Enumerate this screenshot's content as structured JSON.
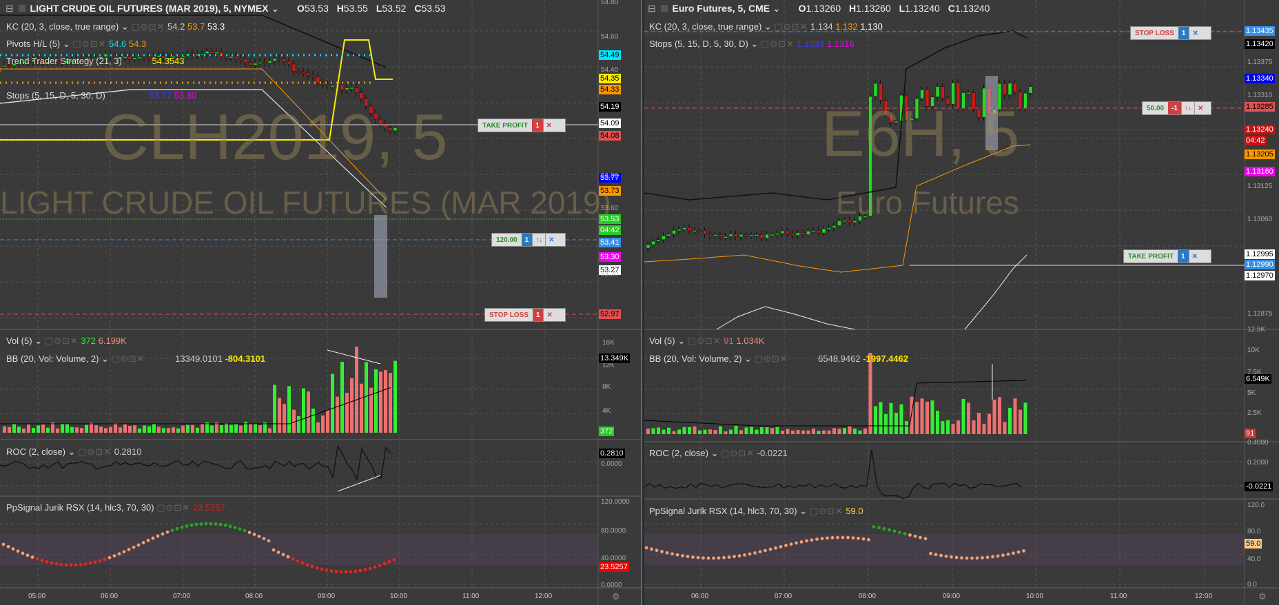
{
  "left": {
    "title": "LIGHT CRUDE OIL FUTURES (MAR 2019), 5, NYMEX",
    "ohlc": {
      "o_label": "O",
      "o": "53.53",
      "h_label": "H",
      "h": "53.55",
      "l_label": "L",
      "l": "53.52",
      "c_label": "C",
      "c": "53.53"
    },
    "indicators": {
      "kc": {
        "name": "KC (20, 3, close, true range)",
        "v1": "54.2",
        "v2": "53.7",
        "v3": "53.3"
      },
      "pivots": {
        "name": "Pivots H/L (5)",
        "v1": "54.6",
        "v2": "54.3"
      },
      "trend": {
        "name": "Trend Trader Strategy (21, 3)",
        "v1": "54.3543"
      },
      "stops": {
        "name": "Stops (5, 15, D, 5, 30, D)",
        "v1": "53.77",
        "v2": "53.30"
      },
      "vol": {
        "name": "Vol (5)",
        "v1": "372",
        "v2": "6.199K"
      },
      "bb": {
        "name": "BB (20, Vol: Volume, 2)",
        "v1": "13349.0101",
        "v2": "-804.3101"
      },
      "roc": {
        "name": "ROC (2, close)",
        "v1": "0.2810"
      },
      "rsx": {
        "name": "PpSignal Jurik RSX (14, hlc3, 70, 30)",
        "v1": "23.5257"
      }
    },
    "watermark_symbol": "CLH2019, 5",
    "watermark_name": "LIGHT CRUDE OIL FUTURES (MAR 2019)",
    "price_labels": [
      {
        "text": "54.49",
        "bg": "#00e5ff",
        "fg": "#000"
      },
      {
        "text": "54.35",
        "bg": "#ffeb00",
        "fg": "#000"
      },
      {
        "text": "54.33",
        "bg": "#ff9800",
        "fg": "#000"
      },
      {
        "text": "54.19",
        "bg": "#000000",
        "fg": "#fff"
      },
      {
        "text": "54.09",
        "bg": "#ffffff",
        "fg": "#000"
      },
      {
        "text": "54.08",
        "bg": "#e05050",
        "fg": "#000"
      },
      {
        "text": "53.77",
        "bg": "#0000ee",
        "fg": "#fff"
      },
      {
        "text": "53.73",
        "bg": "#ff9800",
        "fg": "#000"
      },
      {
        "text": "53.53",
        "bg": "#22cc22",
        "fg": "#fff"
      },
      {
        "text": "04:42",
        "bg": "#22cc22",
        "fg": "#fff"
      },
      {
        "text": "53.41",
        "bg": "#3a8ee6",
        "fg": "#fff"
      },
      {
        "text": "53.30",
        "bg": "#ee00ee",
        "fg": "#fff"
      },
      {
        "text": "53.27",
        "bg": "#ffffff",
        "fg": "#000"
      },
      {
        "text": "52.97",
        "bg": "#e05050",
        "fg": "#000"
      }
    ],
    "price_ticks": [
      "54.80",
      "54.60",
      "54.40",
      "53.80",
      "53.60",
      "53.20"
    ],
    "vol_label": {
      "text": "13.349K",
      "bg": "#000",
      "fg": "#fff"
    },
    "vol_label2": {
      "text": "372",
      "bg": "#22cc22",
      "fg": "#fff"
    },
    "vol_ticks": [
      "16K",
      "12K",
      "8K",
      "4K"
    ],
    "roc_label": {
      "text": "0.2810",
      "bg": "#000",
      "fg": "#fff"
    },
    "roc_ticks": [
      "0.0000"
    ],
    "rsx_label": {
      "text": "23.5257",
      "bg": "#ee0000",
      "fg": "#fff"
    },
    "rsx_ticks": [
      "120.0000",
      "80.0000",
      "40.0000",
      "0.0000"
    ],
    "time_ticks": [
      "05:00",
      "06:00",
      "07:00",
      "08:00",
      "09:00",
      "10:00",
      "11:00",
      "12:00"
    ],
    "orders": {
      "take_profit": {
        "label": "TAKE PROFIT",
        "qty": "1"
      },
      "position": {
        "label": "120.00",
        "qty": "1",
        "arrows": "↑↓"
      },
      "stop_loss": {
        "label": "STOP LOSS",
        "qty": "1"
      }
    }
  },
  "right": {
    "title": "Euro Futures, 5, CME",
    "ohlc": {
      "o_label": "O",
      "o": "1.13260",
      "h_label": "H",
      "h": "1.13260",
      "l_label": "L",
      "l": "1.13240",
      "c_label": "C",
      "c": "1.13240"
    },
    "indicators": {
      "kc": {
        "name": "KC (20, 3, close, true range)",
        "v1": "1.134",
        "v2": "1.132",
        "v3": "1.130"
      },
      "stops": {
        "name": "Stops (5, 15, D, 5, 30, D)",
        "v1": "1.1334",
        "v2": "1.1316"
      },
      "vol": {
        "name": "Vol (5)",
        "v1": "91",
        "v2": "1.034K"
      },
      "bb": {
        "name": "BB (20, Vol: Volume, 2)",
        "v1": "6548.9462",
        "v2": "-1997.4462"
      },
      "roc": {
        "name": "ROC (2, close)",
        "v1": "-0.0221"
      },
      "rsx": {
        "name": "PpSignal Jurik RSX (14, hlc3, 70, 30)",
        "v1": "59.0"
      }
    },
    "watermark_symbol": "E6H, 5",
    "watermark_name": "Euro Futures",
    "price_labels": [
      {
        "text": "1.13435",
        "bg": "#3a8ee6",
        "fg": "#fff"
      },
      {
        "text": "1.13420",
        "bg": "#000000",
        "fg": "#fff"
      },
      {
        "text": "1.13340",
        "bg": "#0000ee",
        "fg": "#fff"
      },
      {
        "text": "1.13285",
        "bg": "#e05050",
        "fg": "#000"
      },
      {
        "text": "1.13240",
        "bg": "#cc1111",
        "fg": "#fff"
      },
      {
        "text": "04:42",
        "bg": "#cc1111",
        "fg": "#fff"
      },
      {
        "text": "1.13205",
        "bg": "#ff9800",
        "fg": "#000"
      },
      {
        "text": "1.13160",
        "bg": "#ee00ee",
        "fg": "#fff"
      },
      {
        "text": "1.12995",
        "bg": "#ffffff",
        "fg": "#000"
      },
      {
        "text": "1.12990",
        "bg": "#3a8ee6",
        "fg": "#fff"
      },
      {
        "text": "1.12970",
        "bg": "#ffffff",
        "fg": "#000"
      }
    ],
    "price_ticks": [
      "1.13375",
      "1.13310",
      "1.13125",
      "1.13060",
      "1.12875"
    ],
    "vol_label": {
      "text": "6.549K",
      "bg": "#000",
      "fg": "#fff"
    },
    "vol_label2": {
      "text": "91",
      "bg": "#cc3333",
      "fg": "#fff"
    },
    "vol_ticks": [
      "12.5K",
      "10K",
      "7.5K",
      "5K",
      "2.5K"
    ],
    "roc_label": {
      "text": "-0.0221",
      "bg": "#000",
      "fg": "#fff"
    },
    "roc_ticks": [
      "0.4000",
      "0.2000"
    ],
    "rsx_label": {
      "text": "59.0",
      "bg": "#ffcc88",
      "fg": "#000"
    },
    "rsx_ticks": [
      "120.0",
      "80.0",
      "40.0",
      "0.0"
    ],
    "time_ticks": [
      "06:00",
      "07:00",
      "08:00",
      "09:00",
      "10:00",
      "11:00",
      "12:00"
    ],
    "orders": {
      "stop_loss": {
        "label": "STOP LOSS",
        "qty": "1"
      },
      "position": {
        "label": "50.00",
        "qty": "-1",
        "arrows": "↑↓"
      },
      "take_profit": {
        "label": "TAKE PROFIT",
        "qty": "1"
      }
    }
  },
  "colors": {
    "bg": "#3a3a3a",
    "up": "#22dd22",
    "down": "#cc1a1a",
    "vol_up": "#33ee33",
    "vol_down": "#ee7070",
    "grid": "#555555"
  }
}
